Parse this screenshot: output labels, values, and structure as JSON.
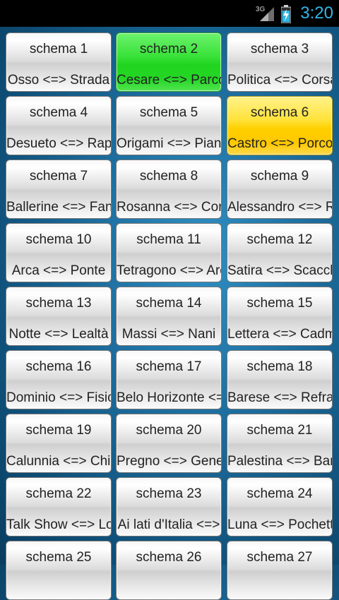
{
  "status_bar": {
    "network": "3G",
    "time": "3:20",
    "accent": "#33b5e5"
  },
  "colors": {
    "solved": "#22d422",
    "in_progress": "#ffd000",
    "default": "#e0e0e0"
  },
  "tiles": [
    {
      "title": "schema 1",
      "pair": "Osso <=> Strada",
      "state": "default"
    },
    {
      "title": "schema 2",
      "pair": "Cesare <=> Parco",
      "state": "green"
    },
    {
      "title": "schema 3",
      "pair": "Politica <=> Corsa",
      "state": "default"
    },
    {
      "title": "schema 4",
      "pair": "Desueto <=> Rapido",
      "state": "default"
    },
    {
      "title": "schema 5",
      "pair": "Origami <=> Piano",
      "state": "default"
    },
    {
      "title": "schema 6",
      "pair": "Castro <=> Porco",
      "state": "yellow"
    },
    {
      "title": "schema 7",
      "pair": "Ballerine <=> Fante",
      "state": "default"
    },
    {
      "title": "schema 8",
      "pair": "Rosanna <=> Coro",
      "state": "default"
    },
    {
      "title": "schema 9",
      "pair": "Alessandro <=> Re",
      "state": "default"
    },
    {
      "title": "schema 10",
      "pair": "Arca <=> Ponte",
      "state": "default"
    },
    {
      "title": "schema 11",
      "pair": "Tetragono <=> Arco",
      "state": "default"
    },
    {
      "title": "schema 12",
      "pair": "Satira <=> Scacchi",
      "state": "default"
    },
    {
      "title": "schema 13",
      "pair": "Notte <=> Lealtà",
      "state": "default"
    },
    {
      "title": "schema 14",
      "pair": "Massi <=> Nani",
      "state": "default"
    },
    {
      "title": "schema 15",
      "pair": "Lettera <=> Cadmio",
      "state": "default"
    },
    {
      "title": "schema 16",
      "pair": "Dominio <=> Fisica",
      "state": "default"
    },
    {
      "title": "schema 17",
      "pair": "Belo Horizonte <=> ",
      "state": "default"
    },
    {
      "title": "schema 18",
      "pair": "Barese <=> Refrain",
      "state": "default"
    },
    {
      "title": "schema 19",
      "pair": "Calunnia <=> Chiesa",
      "state": "default"
    },
    {
      "title": "schema 20",
      "pair": "Pregno <=> Genere",
      "state": "default"
    },
    {
      "title": "schema 21",
      "pair": "Palestina <=> Bara",
      "state": "default"
    },
    {
      "title": "schema 22",
      "pair": "Talk Show <=> Lotto",
      "state": "default"
    },
    {
      "title": "schema 23",
      "pair": "Ai lati d'Italia <=> ",
      "state": "default"
    },
    {
      "title": "schema 24",
      "pair": "Luna <=> Pochette",
      "state": "default"
    },
    {
      "title": "schema 25",
      "pair": "",
      "state": "default"
    },
    {
      "title": "schema 26",
      "pair": "",
      "state": "default"
    },
    {
      "title": "schema 27",
      "pair": "",
      "state": "default"
    }
  ]
}
